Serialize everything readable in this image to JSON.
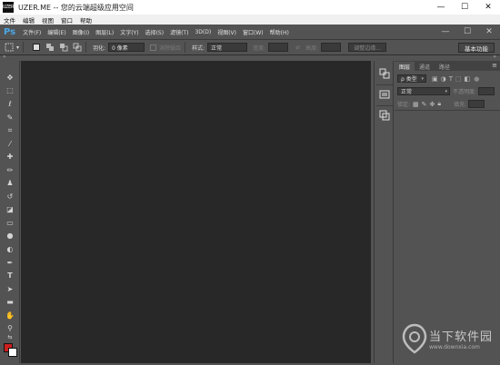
{
  "window": {
    "title": "UZER.ME -- 您的云端超级应用空间",
    "logo_text": "UZER",
    "controls": [
      "—",
      "☐",
      "✕"
    ]
  },
  "window_menu": [
    "文件",
    "编辑",
    "视图",
    "窗口",
    "帮助"
  ],
  "ps_menu": {
    "logo": "Ps",
    "items": [
      "文件(F)",
      "编辑(E)",
      "图像(I)",
      "图层(L)",
      "文字(Y)",
      "选择(S)",
      "滤镜(T)",
      "3D(D)",
      "视图(V)",
      "窗口(W)",
      "帮助(H)"
    ],
    "controls": [
      "—",
      "☐",
      "✕"
    ]
  },
  "options_bar": {
    "feather_label": "羽化:",
    "feather_value": "0 像素",
    "antialias_label": "消除锯齿",
    "style_label": "样式:",
    "style_value": "正常",
    "width_label": "宽度:",
    "height_label": "高度:",
    "refine_edge": "调整边缘...",
    "workspace": "基本功能"
  },
  "collapse_left": "»",
  "collapse_right": "«",
  "tools": [
    {
      "name": "move-tool",
      "glyph": "✥"
    },
    {
      "name": "marquee-tool",
      "glyph": "⬚"
    },
    {
      "name": "lasso-tool",
      "glyph": "ℓ"
    },
    {
      "name": "quick-select-tool",
      "glyph": "✎"
    },
    {
      "name": "crop-tool",
      "glyph": "⌗"
    },
    {
      "name": "eyedropper-tool",
      "glyph": "⁄"
    },
    {
      "name": "healing-brush-tool",
      "glyph": "✚"
    },
    {
      "name": "brush-tool",
      "glyph": "✏"
    },
    {
      "name": "clone-stamp-tool",
      "glyph": "♟"
    },
    {
      "name": "history-brush-tool",
      "glyph": "↺"
    },
    {
      "name": "eraser-tool",
      "glyph": "◪"
    },
    {
      "name": "gradient-tool",
      "glyph": "▭"
    },
    {
      "name": "blur-tool",
      "glyph": "●"
    },
    {
      "name": "dodge-tool",
      "glyph": "◐"
    },
    {
      "name": "pen-tool",
      "glyph": "✒"
    },
    {
      "name": "type-tool",
      "glyph": "T"
    },
    {
      "name": "path-select-tool",
      "glyph": "➤"
    },
    {
      "name": "rectangle-tool",
      "glyph": "▬"
    },
    {
      "name": "hand-tool",
      "glyph": "✋"
    },
    {
      "name": "zoom-tool",
      "glyph": "⚲"
    }
  ],
  "colors": {
    "foreground": "#cc1f1f",
    "background": "#ffffff"
  },
  "dock_icons": [
    "history-icon",
    "properties-icon",
    "adjustments-icon"
  ],
  "layers_panel": {
    "tabs": [
      "图层",
      "通道",
      "路径"
    ],
    "active_tab": 0,
    "menu_glyph": "≡",
    "filter_kind": "ρ 类型",
    "blend_mode": "正常",
    "opacity_label": "不透明度:",
    "lock_label": "锁定:",
    "fill_label": "填充:"
  },
  "watermark": {
    "name": "当下软件园",
    "url": "www.downxia.com"
  }
}
